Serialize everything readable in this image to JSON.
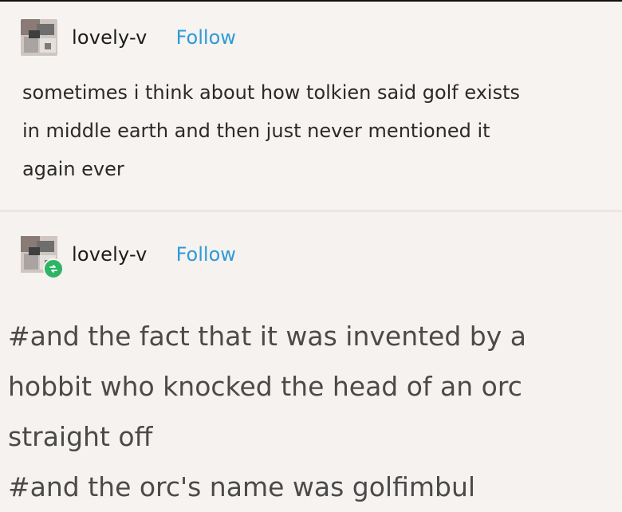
{
  "post": {
    "username": "lovely-v",
    "follow_label": "Follow",
    "lines": [
      "sometimes i think about how tolkien said golf exists",
      "in middle earth and then just never mentioned it",
      "again ever"
    ]
  },
  "reblog": {
    "username": "lovely-v",
    "follow_label": "Follow",
    "tags": [
      "#and the fact that it was invented by a",
      "hobbit who knocked the head of an orc",
      "straight off",
      "#and the orc's name was golfimbul"
    ]
  },
  "colors": {
    "follow": "#2e9ad6",
    "reblog_badge": "#2bb564"
  }
}
